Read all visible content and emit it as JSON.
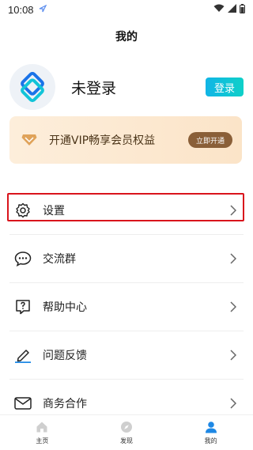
{
  "status": {
    "time": "10:08"
  },
  "header": {
    "title": "我的"
  },
  "profile": {
    "username": "未登录",
    "login_label": "登录"
  },
  "vip": {
    "text": "开通VIP畅享会员权益",
    "button_label": "立即开通"
  },
  "menu": [
    {
      "label": "设置",
      "icon": "gear-icon"
    },
    {
      "label": "交流群",
      "icon": "chat-icon"
    },
    {
      "label": "帮助中心",
      "icon": "help-icon"
    },
    {
      "label": "问题反馈",
      "icon": "pencil-icon"
    },
    {
      "label": "商务合作",
      "icon": "mail-icon"
    }
  ],
  "tabs": [
    {
      "label": "主页",
      "icon": "home-icon"
    },
    {
      "label": "发现",
      "icon": "compass-icon"
    },
    {
      "label": "我的",
      "icon": "user-icon",
      "active": true
    }
  ],
  "colors": {
    "accent": "#1e88e5",
    "highlight": "#d9141c",
    "vip_button": "#8a5f38"
  }
}
